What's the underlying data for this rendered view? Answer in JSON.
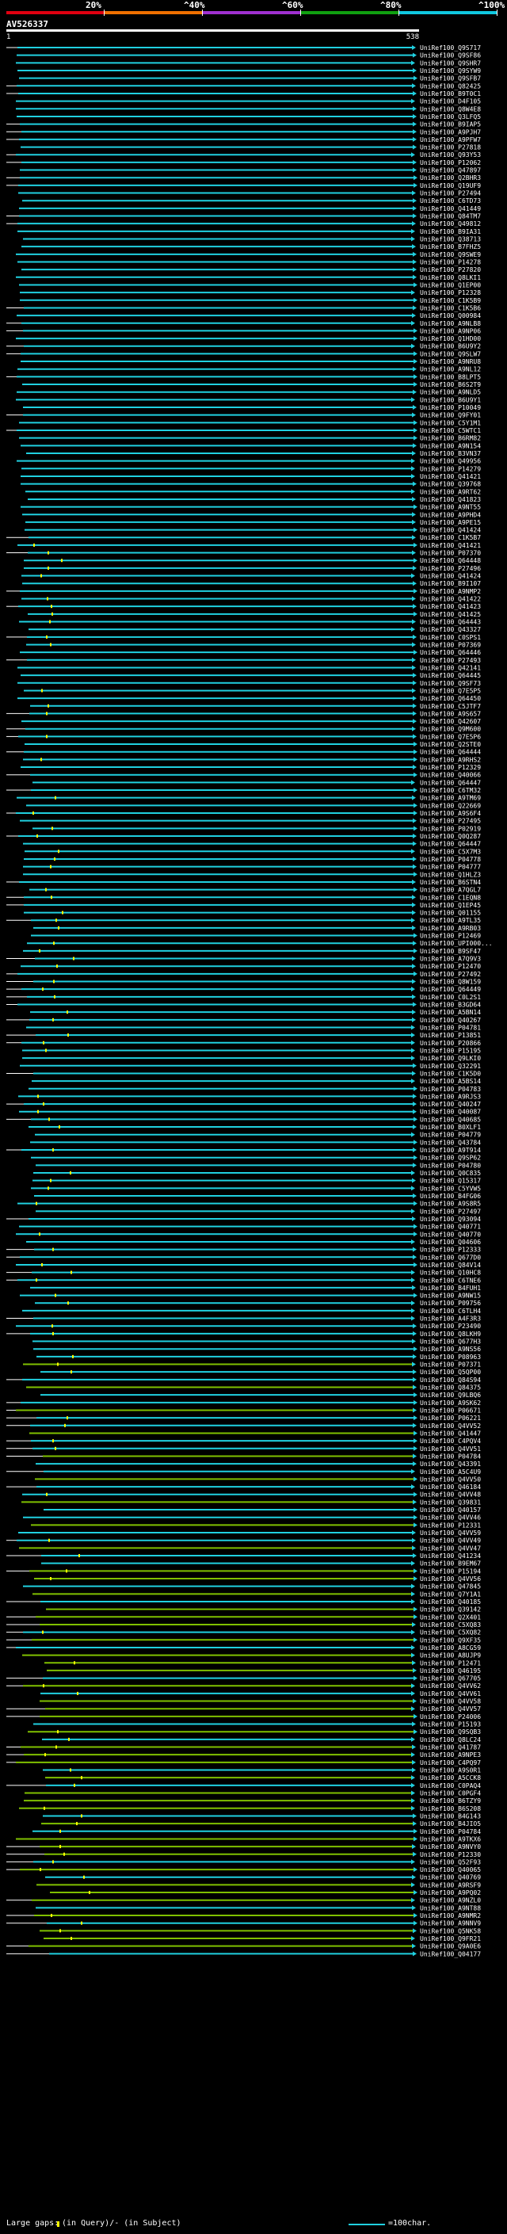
{
  "header": {
    "scale_labels": [
      "20%",
      "^40%",
      "^60%",
      "^80%",
      "^100%"
    ],
    "scale_colors": [
      "#e00010",
      "#f07000",
      "#a030d0",
      "#10a010",
      "#10c8e0"
    ],
    "query_id": "AV526337",
    "ruler_start": "1",
    "ruler_end": "538"
  },
  "legend": {
    "large_gaps_label": "Large gaps:",
    "query_gap_label": "(in Query)/- (in Subject)",
    "scale_label": "=100char."
  },
  "chart_data": {
    "type": "alignment-overview",
    "query_length": 538,
    "scale": "100 characters",
    "colors": {
      "hit": "#20d0e0",
      "hit_alt": "#80c000",
      "query_gap": "#ffff00",
      "connector": "#ffffff",
      "arrow": "#20d0e0"
    },
    "hits": [
      {
        "name": "UniRef100_Q9S717"
      },
      {
        "name": "UniRef100_Q9SF86"
      },
      {
        "name": "UniRef100_Q9SHR7"
      },
      {
        "name": "UniRef100_Q9SYW9"
      },
      {
        "name": "UniRef100_Q9SFB7"
      },
      {
        "name": "UniRef100_Q82425"
      },
      {
        "name": "UniRef100_B9T0C1"
      },
      {
        "name": "UniRef100_D4F105"
      },
      {
        "name": "UniRef100_Q8W4E8"
      },
      {
        "name": "UniRef100_Q3LFQ5"
      },
      {
        "name": "UniRef100_B9IAP5"
      },
      {
        "name": "UniRef100_A9PJH7"
      },
      {
        "name": "UniRef100_A9PFW7"
      },
      {
        "name": "UniRef100_P27818"
      },
      {
        "name": "UniRef100_Q93Y53"
      },
      {
        "name": "UniRef100_P12062"
      },
      {
        "name": "UniRef100_Q47897"
      },
      {
        "name": "UniRef100_Q2BHR3"
      },
      {
        "name": "UniRef100_Q19UF9"
      },
      {
        "name": "UniRef100_P27494"
      },
      {
        "name": "UniRef100_C6TD73"
      },
      {
        "name": "UniRef100_Q41449"
      },
      {
        "name": "UniRef100_Q84TM7"
      },
      {
        "name": "UniRef100_Q49812"
      },
      {
        "name": "UniRef100_B9IA31"
      },
      {
        "name": "UniRef100_Q38713"
      },
      {
        "name": "UniRef100_B7FHZ5"
      },
      {
        "name": "UniRef100_Q9SWE9"
      },
      {
        "name": "UniRef100_P14278"
      },
      {
        "name": "UniRef100_P27820"
      },
      {
        "name": "UniRef100_Q8LKI1"
      },
      {
        "name": "UniRef100_Q1EP00"
      },
      {
        "name": "UniRef100_P12328"
      },
      {
        "name": "UniRef100_C1K5B9"
      },
      {
        "name": "UniRef100_C1K5B6"
      },
      {
        "name": "UniRef100_Q00984"
      },
      {
        "name": "UniRef100_A9NLB8"
      },
      {
        "name": "UniRef100_A9NP06"
      },
      {
        "name": "UniRef100_Q1HD00"
      },
      {
        "name": "UniRef100_B6U9Y2"
      },
      {
        "name": "UniRef100_Q9SLW7"
      },
      {
        "name": "UniRef100_A9NRU8"
      },
      {
        "name": "UniRef100_A9NL12"
      },
      {
        "name": "UniRef100_B8LPT5"
      },
      {
        "name": "UniRef100_B6S2T9"
      },
      {
        "name": "UniRef100_A9NLD5"
      },
      {
        "name": "UniRef100_B6U9Y1"
      },
      {
        "name": "UniRef100_P10049"
      },
      {
        "name": "UniRef100_Q9FY01"
      },
      {
        "name": "UniRef100_C5Y1M1"
      },
      {
        "name": "UniRef100_C5WTC1"
      },
      {
        "name": "UniRef100_B6RM82"
      },
      {
        "name": "UniRef100_A9N154"
      },
      {
        "name": "UniRef100_B3VN37"
      },
      {
        "name": "UniRef100_Q49956"
      },
      {
        "name": "UniRef100_P14279"
      },
      {
        "name": "UniRef100_Q41421"
      },
      {
        "name": "UniRef100_Q39768"
      },
      {
        "name": "UniRef100_A9RT62"
      },
      {
        "name": "UniRef100_Q41823"
      },
      {
        "name": "UniRef100_A9NT55"
      },
      {
        "name": "UniRef100_A9PHD4"
      },
      {
        "name": "UniRef100_A9PE15"
      },
      {
        "name": "UniRef100_Q41424"
      },
      {
        "name": "UniRef100_C1K5B7"
      },
      {
        "name": "UniRef100_Q41421"
      },
      {
        "name": "UniRef100_P07370"
      },
      {
        "name": "UniRef100_Q64448"
      },
      {
        "name": "UniRef100_P27496"
      },
      {
        "name": "UniRef100_Q41424"
      },
      {
        "name": "UniRef100_B9I107"
      },
      {
        "name": "UniRef100_A9NMP2"
      },
      {
        "name": "UniRef100_Q41422"
      },
      {
        "name": "UniRef100_Q41423"
      },
      {
        "name": "UniRef100_Q41425"
      },
      {
        "name": "UniRef100_Q64443"
      },
      {
        "name": "UniRef100_Q43327"
      },
      {
        "name": "UniRef100_C0SPS1"
      },
      {
        "name": "UniRef100_P07369"
      },
      {
        "name": "UniRef100_Q64446"
      },
      {
        "name": "UniRef100_P27493"
      },
      {
        "name": "UniRef100_Q42141"
      },
      {
        "name": "UniRef100_Q64445"
      },
      {
        "name": "UniRef100_Q9SF73"
      },
      {
        "name": "UniRef100_Q7E5P5"
      },
      {
        "name": "UniRef100_Q64450"
      },
      {
        "name": "UniRef100_C5JTF7"
      },
      {
        "name": "UniRef100_A9S657"
      },
      {
        "name": "UniRef100_Q42607"
      },
      {
        "name": "UniRef100_Q9M600"
      },
      {
        "name": "UniRef100_Q7E5P6"
      },
      {
        "name": "UniRef100_Q2STE0"
      },
      {
        "name": "UniRef100_Q64444"
      },
      {
        "name": "UniRef100_A9RHS2"
      },
      {
        "name": "UniRef100_P12329"
      },
      {
        "name": "UniRef100_Q40066"
      },
      {
        "name": "UniRef100_Q64447"
      },
      {
        "name": "UniRef100_C6TM32"
      },
      {
        "name": "UniRef100_A9TM69"
      },
      {
        "name": "UniRef100_Q22669"
      },
      {
        "name": "UniRef100_A9S6F4"
      },
      {
        "name": "UniRef100_P27495"
      },
      {
        "name": "UniRef100_P02919"
      },
      {
        "name": "UniRef100_Q0Q287"
      },
      {
        "name": "UniRef100_Q64447"
      },
      {
        "name": "UniRef100_C5X7M3"
      },
      {
        "name": "UniRef100_P04778"
      },
      {
        "name": "UniRef100_P04777"
      },
      {
        "name": "UniRef100_Q1HLZ3"
      },
      {
        "name": "UniRef100_B6STN4"
      },
      {
        "name": "UniRef100_A7QGL7"
      },
      {
        "name": "UniRef100_C1EQN8"
      },
      {
        "name": "UniRef100_Q1EP45"
      },
      {
        "name": "UniRef100_Q01155"
      },
      {
        "name": "UniRef100_A9TL35"
      },
      {
        "name": "UniRef100_A9RB03"
      },
      {
        "name": "UniRef100_P12469"
      },
      {
        "name": "UniRef100_UPI000..."
      },
      {
        "name": "UniRef100_B9SF47"
      },
      {
        "name": "UniRef100_A7Q9V3"
      },
      {
        "name": "UniRef100_P12470"
      },
      {
        "name": "UniRef100_P27492"
      },
      {
        "name": "UniRef100_Q8W159"
      },
      {
        "name": "UniRef100_Q64449"
      },
      {
        "name": "UniRef100_C0L2S1"
      },
      {
        "name": "UniRef100_B3GD64"
      },
      {
        "name": "UniRef100_A5BN14"
      },
      {
        "name": "UniRef100_Q40267"
      },
      {
        "name": "UniRef100_P04781"
      },
      {
        "name": "UniRef100_P13851"
      },
      {
        "name": "UniRef100_P20866"
      },
      {
        "name": "UniRef100_P15195"
      },
      {
        "name": "UniRef100_Q9LKI0"
      },
      {
        "name": "UniRef100_Q32291"
      },
      {
        "name": "UniRef100_C1K5D0"
      },
      {
        "name": "UniRef100_A5BS14"
      },
      {
        "name": "UniRef100_P04783"
      },
      {
        "name": "UniRef100_A9RJS3"
      },
      {
        "name": "UniRef100_Q40247"
      },
      {
        "name": "UniRef100_Q40087"
      },
      {
        "name": "UniRef100_Q40685"
      },
      {
        "name": "UniRef100_B0XLF1"
      },
      {
        "name": "UniRef100_P04779"
      },
      {
        "name": "UniRef100_Q43784"
      },
      {
        "name": "UniRef100_A9T914"
      },
      {
        "name": "UniRef100_Q9SP62"
      },
      {
        "name": "UniRef100_P04780"
      },
      {
        "name": "UniRef100_Q0C835"
      },
      {
        "name": "UniRef100_Q15317"
      },
      {
        "name": "UniRef100_C5YVW5"
      },
      {
        "name": "UniRef100_B4FG06"
      },
      {
        "name": "UniRef100_A9S8R5"
      },
      {
        "name": "UniRef100_P27497"
      },
      {
        "name": "UniRef100_Q93094"
      },
      {
        "name": "UniRef100_Q40771"
      },
      {
        "name": "UniRef100_Q40770"
      },
      {
        "name": "UniRef100_Q04606"
      },
      {
        "name": "UniRef100_P12333"
      },
      {
        "name": "UniRef100_Q677D0"
      },
      {
        "name": "UniRef100_Q84V14"
      },
      {
        "name": "UniRef100_Q10HC8"
      },
      {
        "name": "UniRef100_C6TNE6"
      },
      {
        "name": "UniRef100_B4FUH1"
      },
      {
        "name": "UniRef100_A9NW15"
      },
      {
        "name": "UniRef100_P09756"
      },
      {
        "name": "UniRef100_C6TLH4"
      },
      {
        "name": "UniRef100_A4F3R3"
      },
      {
        "name": "UniRef100_P23490"
      },
      {
        "name": "UniRef100_Q8LKH9"
      },
      {
        "name": "UniRef100_Q677H3"
      },
      {
        "name": "UniRef100_A9NS56"
      },
      {
        "name": "UniRef100_P08963"
      },
      {
        "name": "UniRef100_P07371"
      },
      {
        "name": "UniRef100_Q5QP00"
      },
      {
        "name": "UniRef100_Q84S94"
      },
      {
        "name": "UniRef100_Q84375"
      },
      {
        "name": "UniRef100_Q9LBQ6"
      },
      {
        "name": "UniRef100_A9SK62"
      },
      {
        "name": "UniRef100_P06671"
      },
      {
        "name": "UniRef100_P06221"
      },
      {
        "name": "UniRef100_Q4VV52"
      },
      {
        "name": "UniRef100_Q41447"
      },
      {
        "name": "UniRef100_C4PQV4"
      },
      {
        "name": "UniRef100_Q4VV51"
      },
      {
        "name": "UniRef100_P04784"
      },
      {
        "name": "UniRef100_Q43391"
      },
      {
        "name": "UniRef100_A5C4U9"
      },
      {
        "name": "UniRef100_Q4VV50"
      },
      {
        "name": "UniRef100_Q46184"
      },
      {
        "name": "UniRef100_Q4VV48"
      },
      {
        "name": "UniRef100_Q39831"
      },
      {
        "name": "UniRef100_Q40157"
      },
      {
        "name": "UniRef100_Q4VV46"
      },
      {
        "name": "UniRef100_P12331"
      },
      {
        "name": "UniRef100_Q4VV59"
      },
      {
        "name": "UniRef100_Q4VV49"
      },
      {
        "name": "UniRef100_Q4VV47"
      },
      {
        "name": "UniRef100_Q41234"
      },
      {
        "name": "UniRef100_B9EM67"
      },
      {
        "name": "UniRef100_P15194"
      },
      {
        "name": "UniRef100_Q4VV56"
      },
      {
        "name": "UniRef100_Q47845"
      },
      {
        "name": "UniRef100_Q7Y1A1"
      },
      {
        "name": "UniRef100_Q40185"
      },
      {
        "name": "UniRef100_Q39142"
      },
      {
        "name": "UniRef100_Q2X401"
      },
      {
        "name": "UniRef100_C5XQ83"
      },
      {
        "name": "UniRef100_C5XQ82"
      },
      {
        "name": "UniRef100_Q9XF35"
      },
      {
        "name": "UniRef100_A8CG59"
      },
      {
        "name": "UniRef100_A8UJP9"
      },
      {
        "name": "UniRef100_P12471"
      },
      {
        "name": "UniRef100_Q46195"
      },
      {
        "name": "UniRef100_Q67705"
      },
      {
        "name": "UniRef100_Q4VV62"
      },
      {
        "name": "UniRef100_Q4VV61"
      },
      {
        "name": "UniRef100_Q4VV58"
      },
      {
        "name": "UniRef100_Q4VV57"
      },
      {
        "name": "UniRef100_P24006"
      },
      {
        "name": "UniRef100_P15193"
      },
      {
        "name": "UniRef100_Q9SQB3"
      },
      {
        "name": "UniRef100_Q8LC24"
      },
      {
        "name": "UniRef100_Q41787"
      },
      {
        "name": "UniRef100_A9NPE3"
      },
      {
        "name": "UniRef100_C4PQ97"
      },
      {
        "name": "UniRef100_A9S0R1"
      },
      {
        "name": "UniRef100_A5CCK8"
      },
      {
        "name": "UniRef100_C0PAQ4"
      },
      {
        "name": "UniRef100_C0PGF4"
      },
      {
        "name": "UniRef100_B6TZY9"
      },
      {
        "name": "UniRef100_B6S208"
      },
      {
        "name": "UniRef100_B4G143"
      },
      {
        "name": "UniRef100_B4JIO5"
      },
      {
        "name": "UniRef100_P04784"
      },
      {
        "name": "UniRef100_A9TKX6"
      },
      {
        "name": "UniRef100_A9NVY0"
      },
      {
        "name": "UniRef100_P12330"
      },
      {
        "name": "UniRef100_Q52F93"
      },
      {
        "name": "UniRef100_Q40065"
      },
      {
        "name": "UniRef100_Q40769"
      },
      {
        "name": "UniRef100_A9RSF9"
      },
      {
        "name": "UniRef100_A9PQ02"
      },
      {
        "name": "UniRef100_A9NZL0"
      },
      {
        "name": "UniRef100_A9NT88"
      },
      {
        "name": "UniRef100_A9NMR2"
      },
      {
        "name": "UniRef100_A9NNV9"
      },
      {
        "name": "UniRef100_Q5NK58"
      },
      {
        "name": "UniRef100_Q9FR21"
      },
      {
        "name": "UniRef100_Q9A0E6"
      },
      {
        "name": "UniRef100_Q04177"
      }
    ]
  }
}
